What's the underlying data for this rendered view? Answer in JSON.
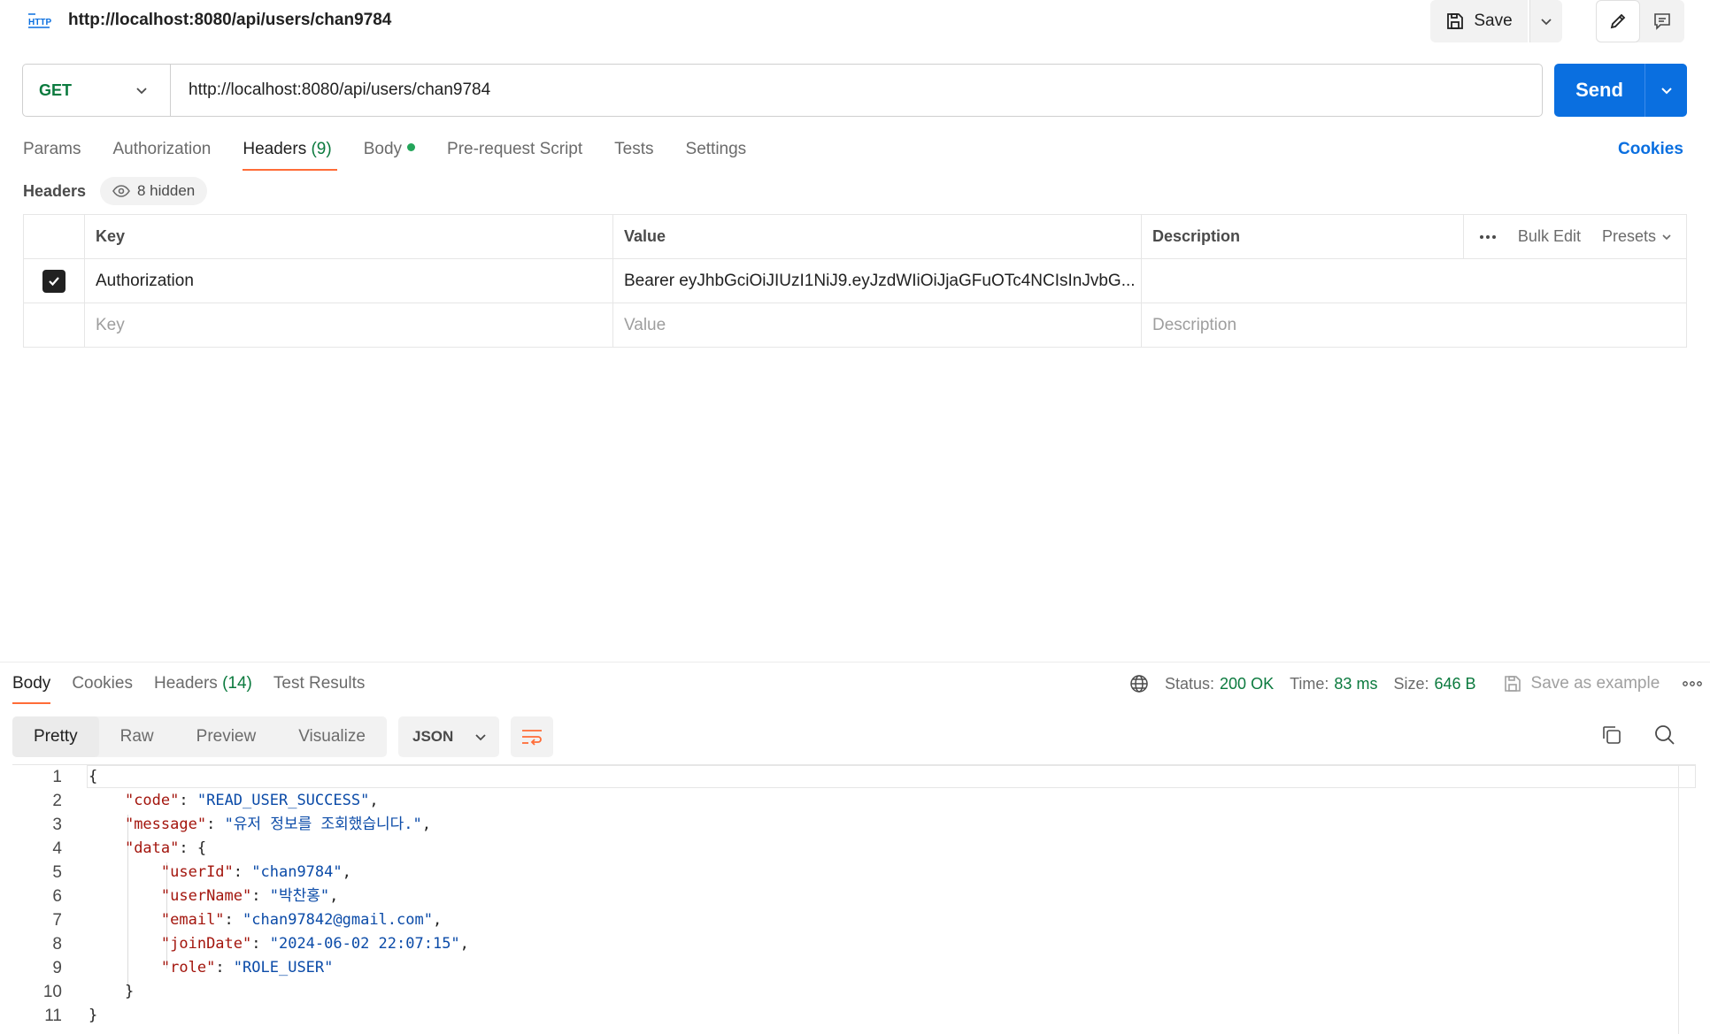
{
  "request": {
    "title": "http://localhost:8080/api/users/chan9784",
    "save_label": "Save",
    "method": "GET",
    "url": "http://localhost:8080/api/users/chan9784",
    "send_label": "Send",
    "cookies_label": "Cookies",
    "tabs": [
      {
        "label": "Params"
      },
      {
        "label": "Authorization"
      },
      {
        "label": "Headers",
        "count": "(9)"
      },
      {
        "label": "Body"
      },
      {
        "label": "Pre-request Script"
      },
      {
        "label": "Tests"
      },
      {
        "label": "Settings"
      }
    ],
    "active_tab": "Headers"
  },
  "headers_panel": {
    "label": "Headers",
    "hidden_label": "8 hidden",
    "columns": {
      "key": "Key",
      "value": "Value",
      "description": "Description"
    },
    "bulk_edit": "Bulk Edit",
    "presets": "Presets",
    "rows": [
      {
        "checked": true,
        "key": "Authorization",
        "value": "Bearer eyJhbGciOiJIUzI1NiJ9.eyJzdWIiOiJjaGFuOTc4NCIsInJvbG...",
        "description": ""
      }
    ],
    "new_row": {
      "key_placeholder": "Key",
      "value_placeholder": "Value",
      "description_placeholder": "Description"
    }
  },
  "response": {
    "tabs": [
      {
        "label": "Body"
      },
      {
        "label": "Cookies"
      },
      {
        "label": "Headers",
        "count": "(14)"
      },
      {
        "label": "Test Results"
      }
    ],
    "status_label": "Status:",
    "status_value": "200 OK",
    "time_label": "Time:",
    "time_value": "83 ms",
    "size_label": "Size:",
    "size_value": "646 B",
    "save_example": "Save as example",
    "view_modes": [
      "Pretty",
      "Raw",
      "Preview",
      "Visualize"
    ],
    "active_view": "Pretty",
    "format": "JSON",
    "line_numbers": [
      "1",
      "2",
      "3",
      "4",
      "5",
      "6",
      "7",
      "8",
      "9",
      "10",
      "11"
    ],
    "code": {
      "l1": "{",
      "code_key": "\"code\"",
      "code_val": "\"READ_USER_SUCCESS\"",
      "message_key": "\"message\"",
      "message_val": "\"유저 정보를 조회했습니다.\"",
      "data_key": "\"data\"",
      "userId_key": "\"userId\"",
      "userId_val": "\"chan9784\"",
      "userName_key": "\"userName\"",
      "userName_val": "\"박찬홍\"",
      "email_key": "\"email\"",
      "email_val": "\"chan97842@gmail.com\"",
      "joinDate_key": "\"joinDate\"",
      "joinDate_val": "\"2024-06-02 22:07:15\"",
      "role_key": "\"role\"",
      "role_val": "\"ROLE_USER\"",
      "inner_close": "}",
      "outer_close": "}"
    }
  },
  "colors": {
    "accent": "#ff6c37",
    "primary": "#0a6fe0",
    "success": "#0b7a3e",
    "json_key": "#a3150d",
    "json_string": "#0b4ba8"
  }
}
